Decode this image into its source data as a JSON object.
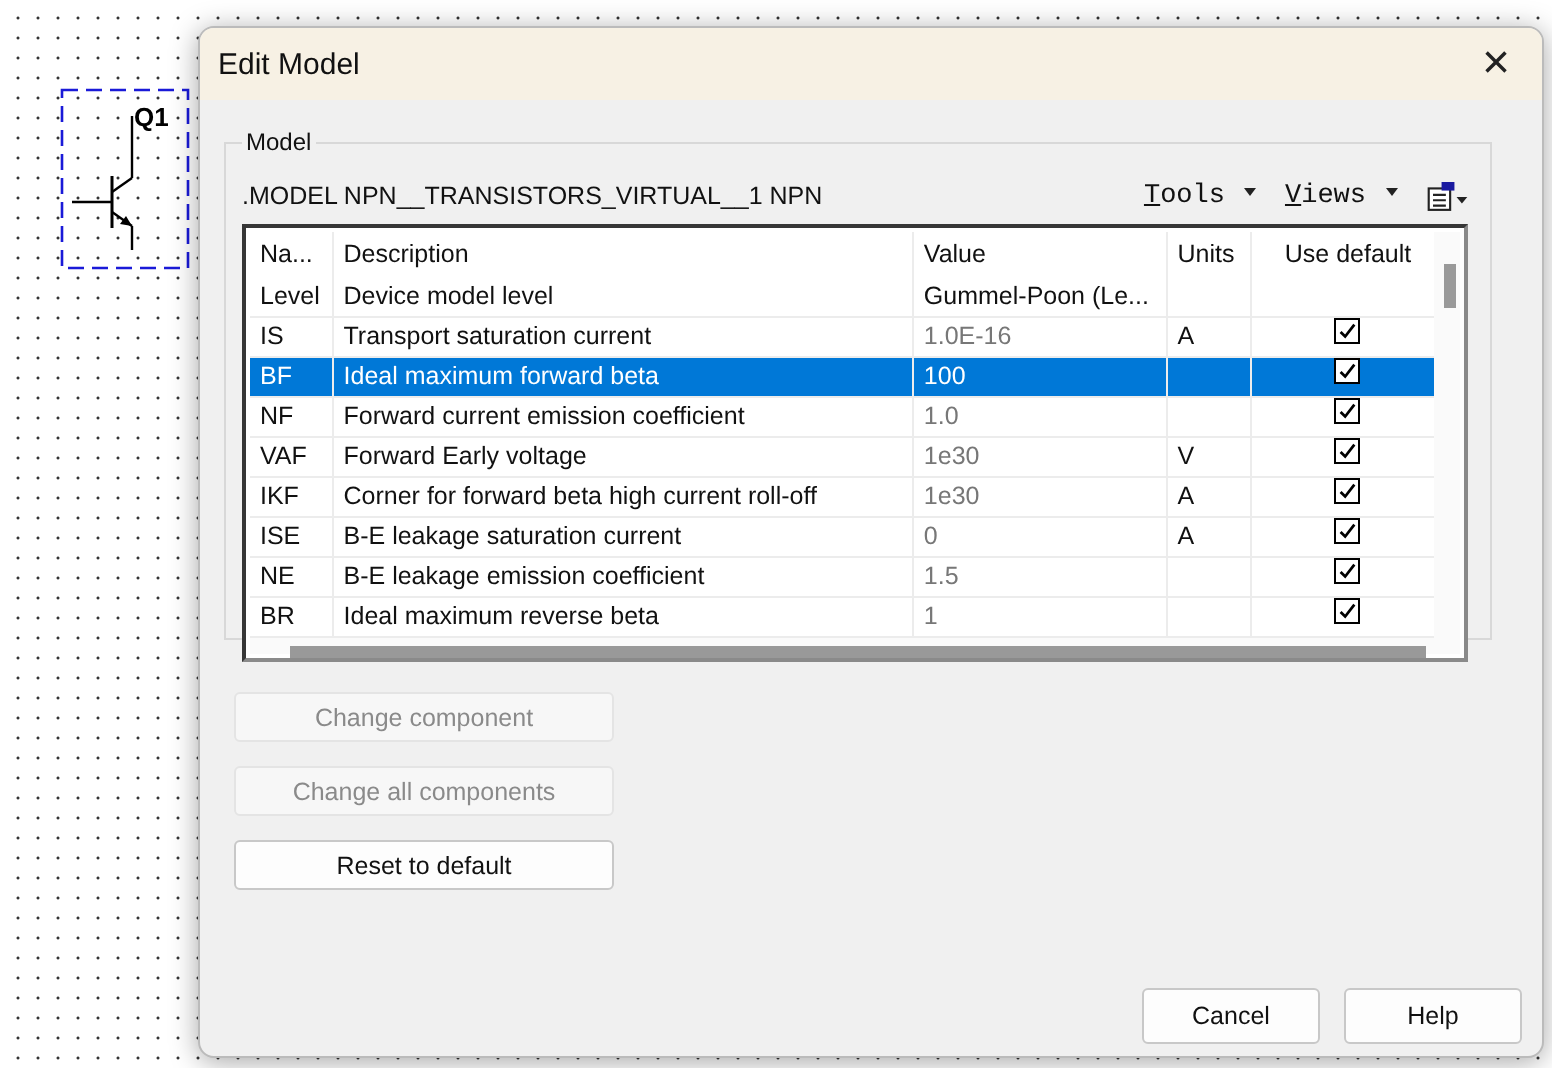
{
  "schematic": {
    "ref": "Q1"
  },
  "window": {
    "title": "Edit Model",
    "close": "×"
  },
  "group": {
    "label": "Model"
  },
  "model_line": ".MODEL NPN__TRANSISTORS_VIRTUAL__1 NPN",
  "toolbar": [
    {
      "kind": "menu",
      "label": "Tools"
    },
    {
      "kind": "menu",
      "label": "Views"
    },
    {
      "kind": "icon"
    }
  ],
  "table": {
    "columns": [
      "Na...",
      "Description",
      "Value",
      "Units",
      "Use default"
    ],
    "rows": [
      {
        "name": "Level",
        "description": "Device model level",
        "value": "Gummel-Poon (Le...",
        "units": "",
        "selected": false
      },
      {
        "name": "IS",
        "description": "Transport saturation current",
        "value": "1.0E-16",
        "units": "A",
        "use_default": true,
        "selected": false
      },
      {
        "name": "BF",
        "description": "Ideal maximum forward beta",
        "value": "100",
        "units": "",
        "use_default": true,
        "selected": true
      },
      {
        "name": "NF",
        "description": "Forward current emission coefficient",
        "value": "1.0",
        "units": "",
        "use_default": true,
        "selected": false
      },
      {
        "name": "VAF",
        "description": "Forward Early voltage",
        "value": "1e30",
        "units": "V",
        "use_default": true,
        "selected": false
      },
      {
        "name": "IKF",
        "description": "Corner for forward beta high current roll-off",
        "value": "1e30",
        "units": "A",
        "use_default": true,
        "selected": false
      },
      {
        "name": "ISE",
        "description": "B-E leakage saturation current",
        "value": "0",
        "units": "A",
        "use_default": true,
        "selected": false
      },
      {
        "name": "NE",
        "description": "B-E leakage emission coefficient",
        "value": "1.5",
        "units": "",
        "use_default": true,
        "selected": false
      },
      {
        "name": "BR",
        "description": "Ideal maximum reverse beta",
        "value": "1",
        "units": "",
        "use_default": true,
        "selected": false
      }
    ]
  },
  "side_buttons": [
    {
      "label": "Change component",
      "disabled": true
    },
    {
      "label": "Change all components",
      "disabled": true
    },
    {
      "label": "Reset to default",
      "disabled": false
    }
  ],
  "footer_buttons": [
    "Cancel",
    "Help"
  ]
}
